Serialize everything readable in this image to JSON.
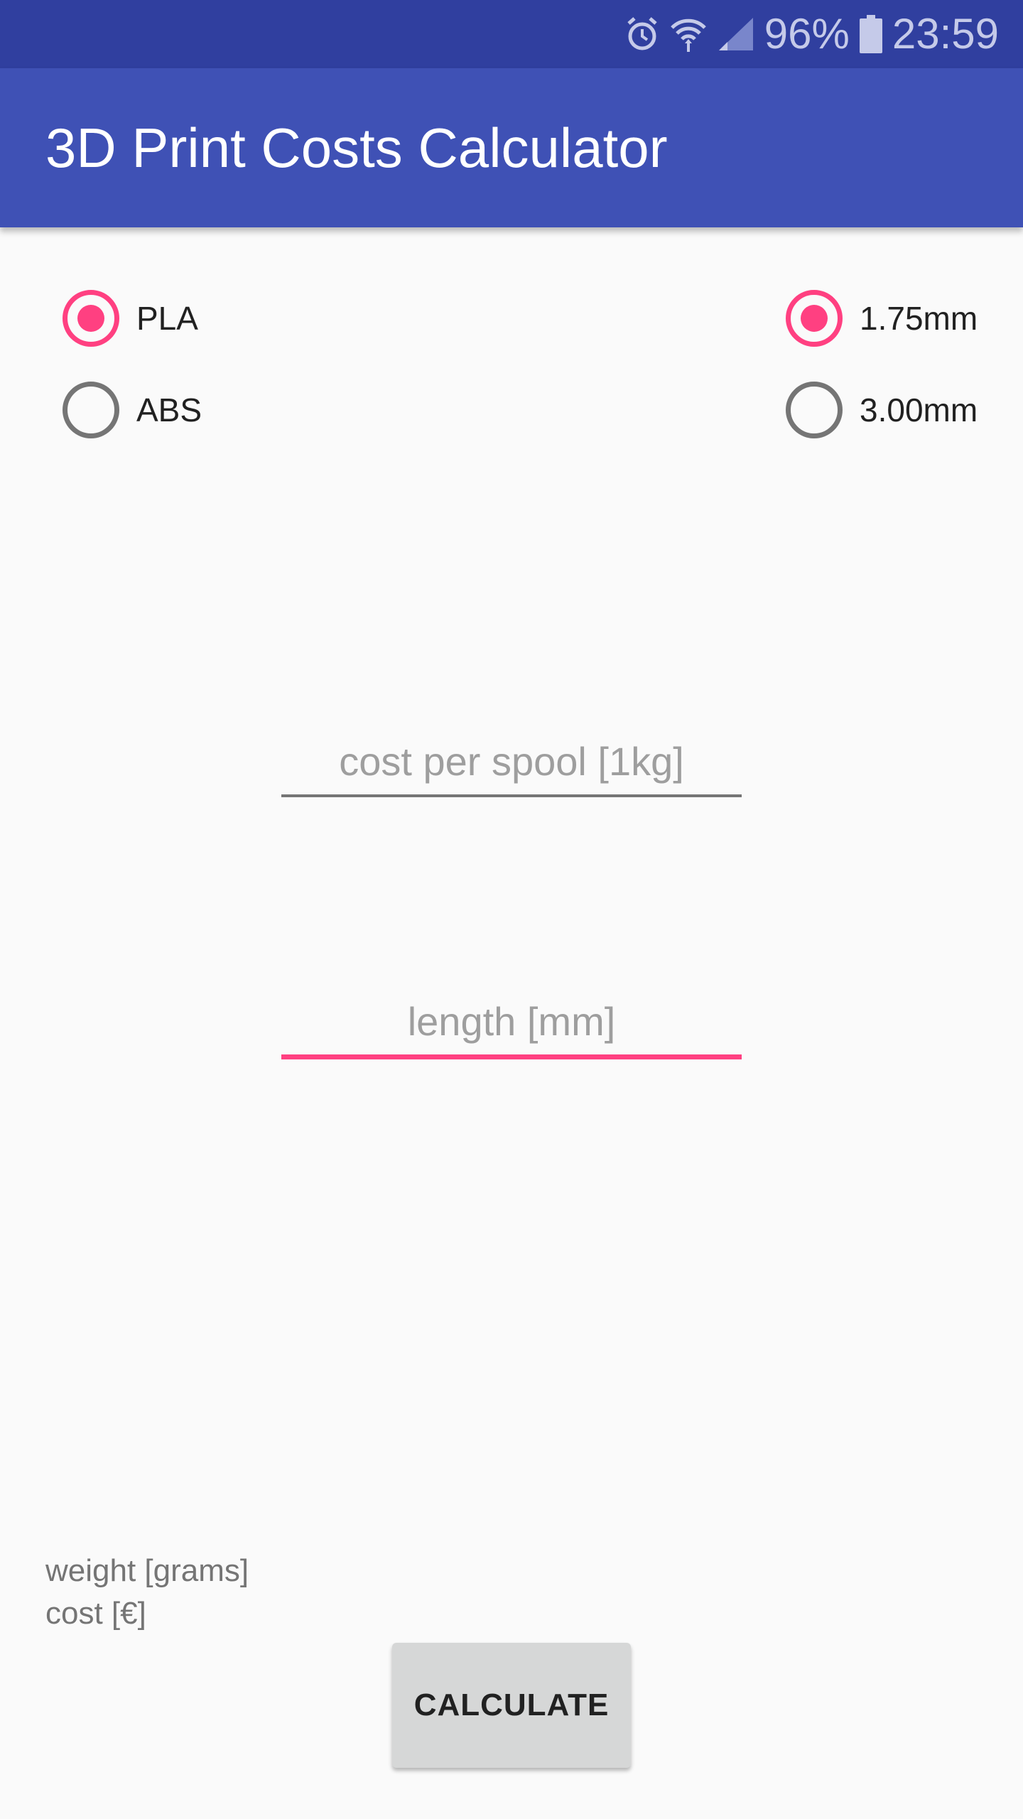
{
  "status_bar": {
    "icons": [
      "alarm-icon",
      "wifi-icon",
      "cell-signal-icon",
      "battery-icon"
    ],
    "battery_percent": "96%",
    "time": "23:59",
    "background": "#303f9f"
  },
  "app_bar": {
    "title": "3D Print Costs Calculator",
    "background": "#3f51b5"
  },
  "material_group": {
    "options": [
      {
        "label": "PLA",
        "checked": true
      },
      {
        "label": "ABS",
        "checked": false
      }
    ]
  },
  "diameter_group": {
    "options": [
      {
        "label": "1.75mm",
        "checked": true
      },
      {
        "label": "3.00mm",
        "checked": false
      }
    ]
  },
  "inputs": {
    "spool_cost": {
      "value": "",
      "placeholder": "cost per spool [1kg]"
    },
    "length": {
      "value": "",
      "placeholder": "length [mm]",
      "focused": true
    }
  },
  "results": {
    "weight_label": "weight [grams]",
    "cost_label": "cost [€]"
  },
  "calculate_button": {
    "label": "CALCULATE"
  },
  "colors": {
    "accent": "#ff4081",
    "primary": "#3f51b5",
    "primary_dark": "#303f9f"
  }
}
